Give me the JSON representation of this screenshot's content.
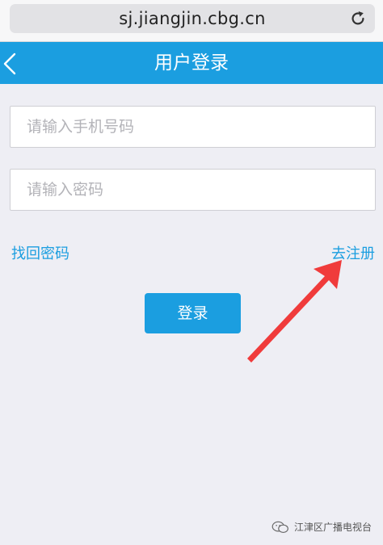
{
  "browser": {
    "url": "sj.jiangjin.cbg.cn"
  },
  "nav": {
    "title": "用户登录"
  },
  "form": {
    "phone_placeholder": "请输入手机号码",
    "password_placeholder": "请输入密码",
    "forgot_link": "找回密码",
    "register_link": "去注册",
    "login_button": "登录"
  },
  "watermark": {
    "text": "江津区广播电视台"
  },
  "colors": {
    "accent": "#1b9ee0",
    "arrow": "#f03b3b",
    "background": "#eeeef4"
  }
}
